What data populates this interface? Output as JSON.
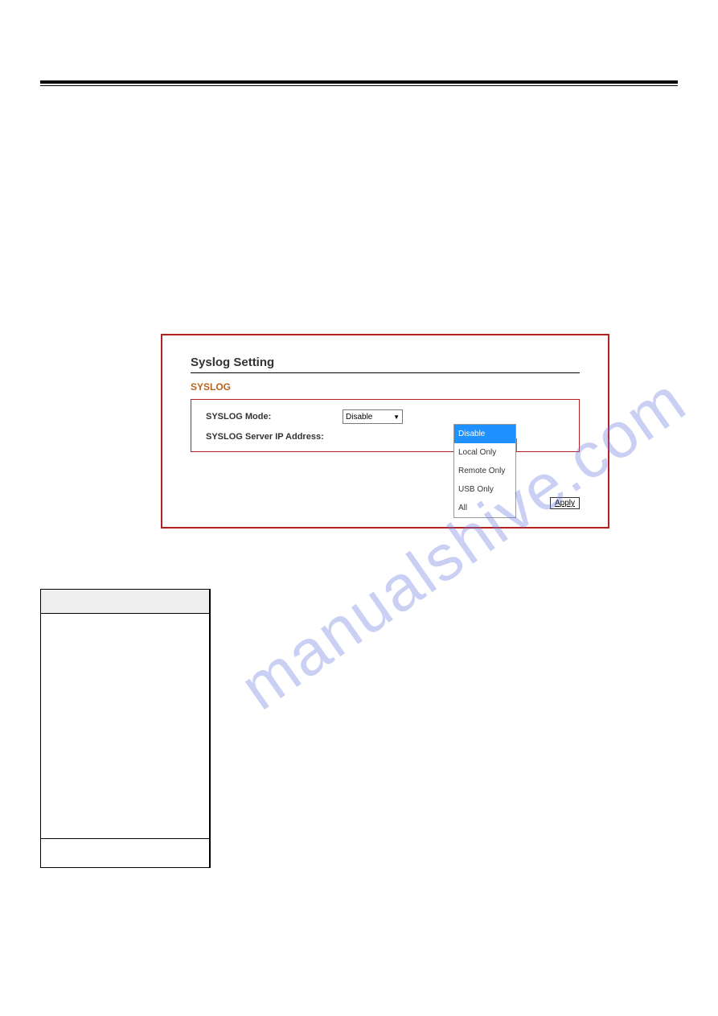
{
  "panel": {
    "title": "Syslog Setting",
    "section_label": "SYSLOG",
    "mode_label": "SYSLOG Mode:",
    "server_label": "SYSLOG Server IP Address:",
    "selected_value": "Disable",
    "dropdown_options": [
      "Disable",
      "Local Only",
      "Remote Only",
      "USB Only",
      "All"
    ],
    "apply_label": "Apply"
  },
  "watermark": "manualshive.com"
}
